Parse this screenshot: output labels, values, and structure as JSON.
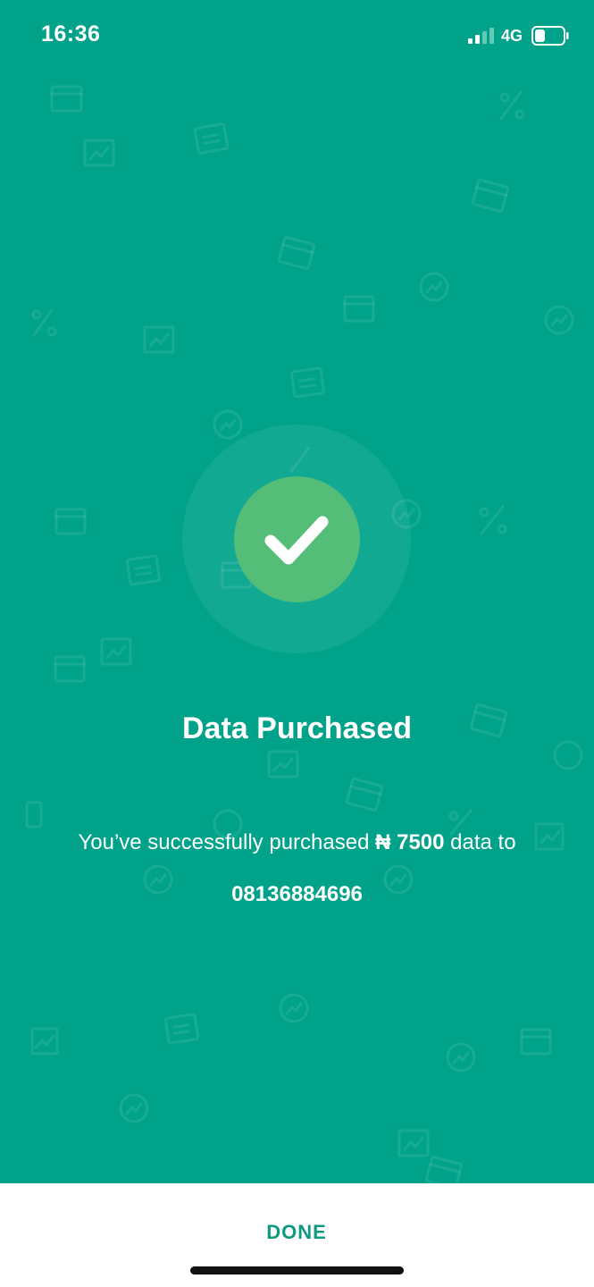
{
  "status_bar": {
    "time": "16:36",
    "network": "4G",
    "signal_icon": "cellular-signal-icon",
    "battery_icon": "battery-icon"
  },
  "success": {
    "icon": "checkmark-icon",
    "title": "Data Purchased",
    "message_prefix": "You’ve successfully purchased ",
    "amount": "₦ 7500",
    "message_suffix": " data to",
    "phone_number": "08136884696"
  },
  "actions": {
    "done_label": "DONE"
  },
  "colors": {
    "background": "#00a38a",
    "check_circle": "#54bd78",
    "button_text": "#0e9a80"
  }
}
